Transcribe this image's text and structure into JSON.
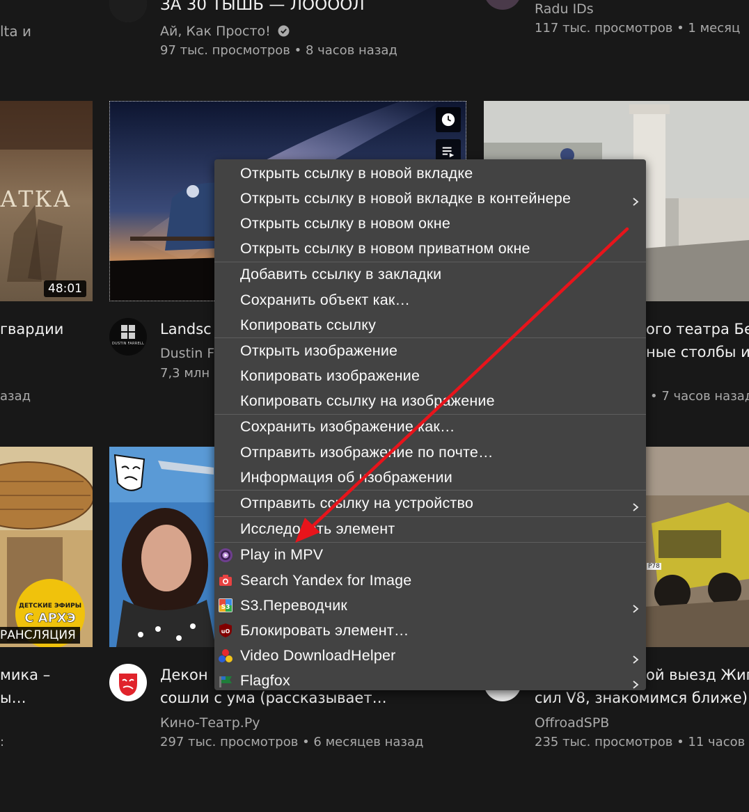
{
  "feed": {
    "row1": {
      "left_title_fragment": "lta и",
      "center_title": "ЗА 30 ТЫШЬ — ЛООООЛ",
      "center_channel": "Ай, Как Просто!",
      "center_views": "97 тыс. просмотров • 8 часов назад",
      "right_channel": "Radu IDs",
      "right_views": "117 тыс. просмотров • 1 месяц"
    },
    "row2": {
      "left_duration": "48:01",
      "left_thumb_text": "АТКА",
      "left_title_fragment": "гвардии",
      "left_meta_fragment": "азад",
      "center_avatar_text": "DUSTIN FARRELL",
      "center_title_fragment": "Landsc",
      "center_channel_fragment": "Dustin F",
      "center_views_fragment": "7,3 млн",
      "right_title_line1": "ого театра Бел",
      "right_title_line2": "ные столбы и",
      "right_meta_fragment": "• 7 часов назад"
    },
    "row3": {
      "left_badge_line1": "ДЕТСКИЕ ЭФИРЫ",
      "left_badge_line2": "С АРХЭ",
      "left_live_label": "РАНСЛЯЦИЯ",
      "left_title_line1": "мика –",
      "left_title_line2": "ы…",
      "left_meta_fragment": ":",
      "center_title_line1": "Декон",
      "center_title_line2": "сошли с ума (рассказывает…",
      "center_channel": "Кино-Театр.Ру",
      "center_views": "297 тыс. просмотров • 6 месяцев назад",
      "right_title_line1": "ой выезд Жиг",
      "right_title_line2": "сил V8, знакомимся ближе)",
      "right_channel": "OffroadSPB",
      "right_views": "235 тыс. просмотров • 11 часов",
      "right_plate": "Р78"
    }
  },
  "context_menu": {
    "groups": [
      [
        {
          "label": "Открыть ссылку в новой вкладке",
          "submenu": false
        },
        {
          "label": "Открыть ссылку в новой вкладке в контейнере",
          "submenu": true
        },
        {
          "label": "Открыть ссылку в новом окне",
          "submenu": false
        },
        {
          "label": "Открыть ссылку в новом приватном окне",
          "submenu": false
        }
      ],
      [
        {
          "label": "Добавить ссылку в закладки",
          "submenu": false
        },
        {
          "label": "Сохранить объект как…",
          "submenu": false
        },
        {
          "label": "Копировать ссылку",
          "submenu": false
        }
      ],
      [
        {
          "label": "Открыть изображение",
          "submenu": false
        },
        {
          "label": "Копировать изображение",
          "submenu": false
        },
        {
          "label": "Копировать ссылку на изображение",
          "submenu": false
        }
      ],
      [
        {
          "label": "Сохранить изображение как…",
          "submenu": false
        },
        {
          "label": "Отправить изображение по почте…",
          "submenu": false
        },
        {
          "label": "Информация об изображении",
          "submenu": false
        }
      ],
      [
        {
          "label": "Отправить ссылку на устройство",
          "submenu": true
        }
      ],
      [
        {
          "label": "Исследовать элемент",
          "submenu": false
        }
      ],
      [
        {
          "label": "Play in MPV",
          "submenu": false,
          "icon": "mpv-icon"
        },
        {
          "label": "Search Yandex for Image",
          "submenu": false,
          "icon": "camera-icon"
        },
        {
          "label": "S3.Переводчик",
          "submenu": true,
          "icon": "s3-translator-icon"
        },
        {
          "label": "Блокировать элемент…",
          "submenu": false,
          "icon": "ublock-icon"
        },
        {
          "label": "Video DownloadHelper",
          "submenu": true,
          "icon": "video-downloadhelper-icon"
        },
        {
          "label": "Flagfox",
          "submenu": true,
          "icon": "flagfox-icon"
        }
      ]
    ]
  },
  "colors": {
    "background": "#181818",
    "menu_bg": "#434343",
    "annotation_arrow": "#e8141b"
  }
}
